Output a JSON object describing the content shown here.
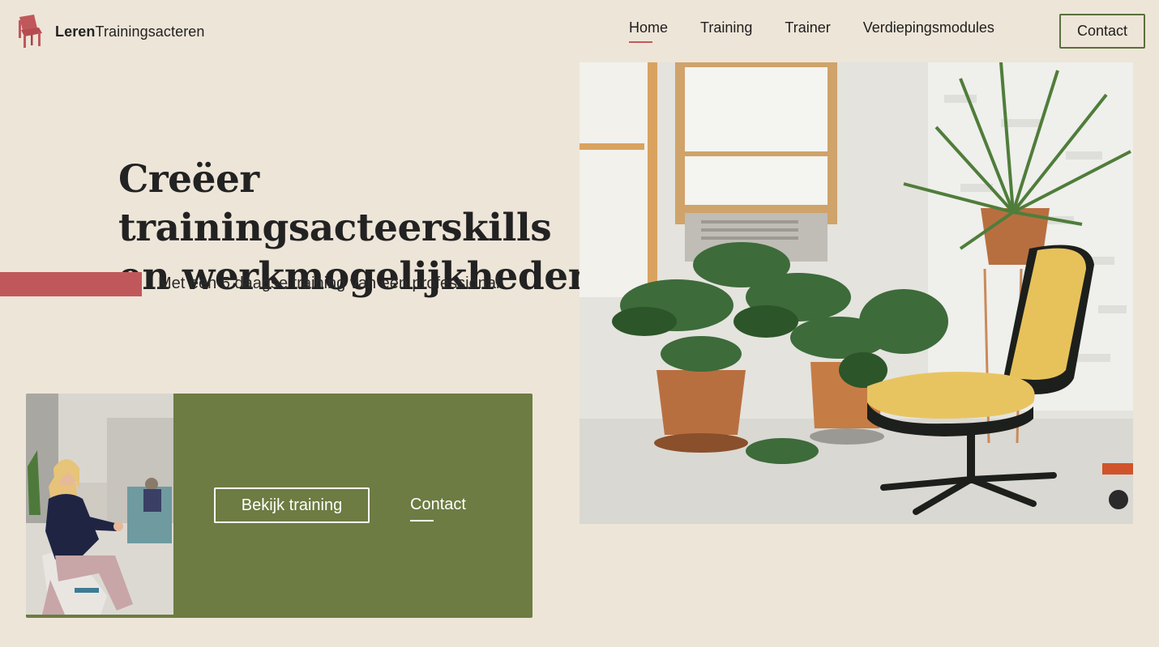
{
  "brand": {
    "bold": "Leren",
    "rest": "Trainingsacteren",
    "logo_icon": "chair-icon",
    "logo_color": "#c0585b"
  },
  "nav": {
    "items": [
      {
        "label": "Home",
        "active": true
      },
      {
        "label": "Training",
        "active": false
      },
      {
        "label": "Trainer",
        "active": false
      },
      {
        "label": "Verdiepingsmodules",
        "active": false
      }
    ],
    "contact_label": "Contact"
  },
  "hero": {
    "title_line1": "Creëer trainingsacteerskills",
    "title_line2": "en werkmogelijkheden",
    "subtitle": "Met een 5 daagse training van een professional"
  },
  "card": {
    "primary_button": "Bekijk training",
    "secondary_link": "Contact",
    "background": "#6c7c42"
  },
  "colors": {
    "background": "#ede5d8",
    "accent": "#c0585b",
    "green": "#59703c"
  }
}
